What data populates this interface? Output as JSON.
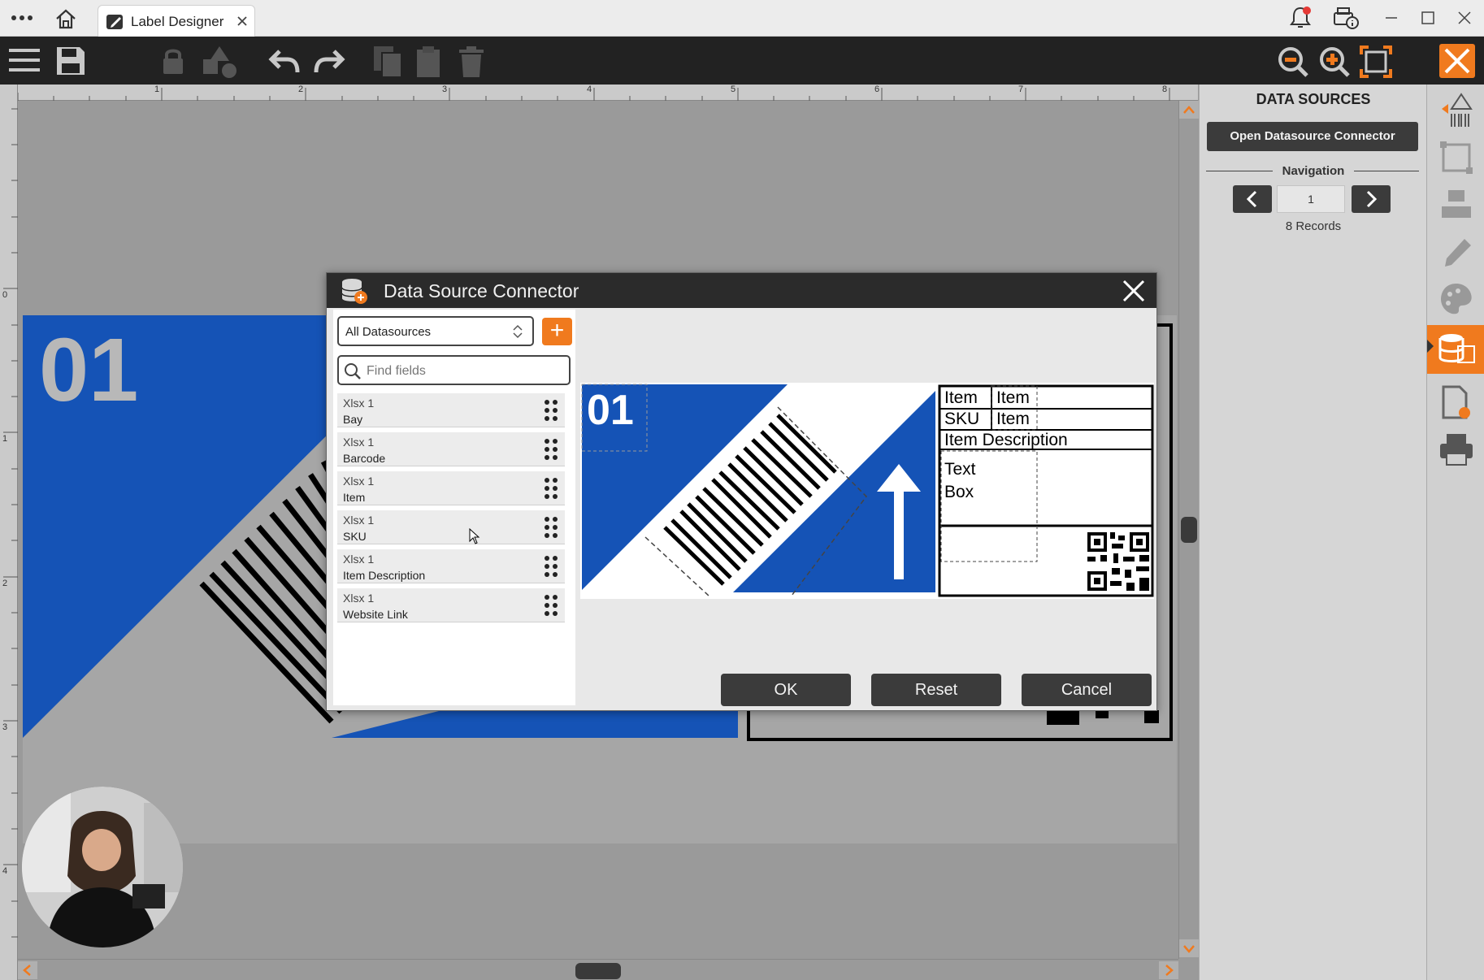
{
  "app": {
    "tab_title": "Label Designer"
  },
  "rulers": {
    "horizontal": [
      "1",
      "2",
      "3",
      "4",
      "5",
      "6",
      "7",
      "8"
    ],
    "vertical": [
      "0",
      "1",
      "2",
      "3",
      "4"
    ]
  },
  "canvas_label": {
    "number": "01"
  },
  "right_panel": {
    "title": "DATA SOURCES",
    "open_button": "Open Datasource Connector",
    "navigation_label": "Navigation",
    "record_value": "1",
    "records_text": "8 Records"
  },
  "dialog": {
    "title": "Data Source Connector",
    "datasource_select": "All Datasources",
    "add_label": "+",
    "search_placeholder": "Find fields",
    "fields": [
      {
        "source": "Xlsx 1",
        "name": "Bay"
      },
      {
        "source": "Xlsx 1",
        "name": "Barcode"
      },
      {
        "source": "Xlsx 1",
        "name": "Item"
      },
      {
        "source": "Xlsx 1",
        "name": "SKU"
      },
      {
        "source": "Xlsx 1",
        "name": "Item Description"
      },
      {
        "source": "Xlsx 1",
        "name": "Website Link"
      }
    ],
    "preview": {
      "number": "01",
      "row1_label": "Item",
      "row1_value": "Item",
      "row2_label": "SKU",
      "row2_value": "Item",
      "row3": "Item Description",
      "textbox_line1": "Text",
      "textbox_line2": "Box"
    },
    "ok_label": "OK",
    "reset_label": "Reset",
    "cancel_label": "Cancel"
  },
  "colors": {
    "label_blue": "#1553b6",
    "accent_orange": "#f07a1e",
    "toolbar_dark": "#222222"
  }
}
